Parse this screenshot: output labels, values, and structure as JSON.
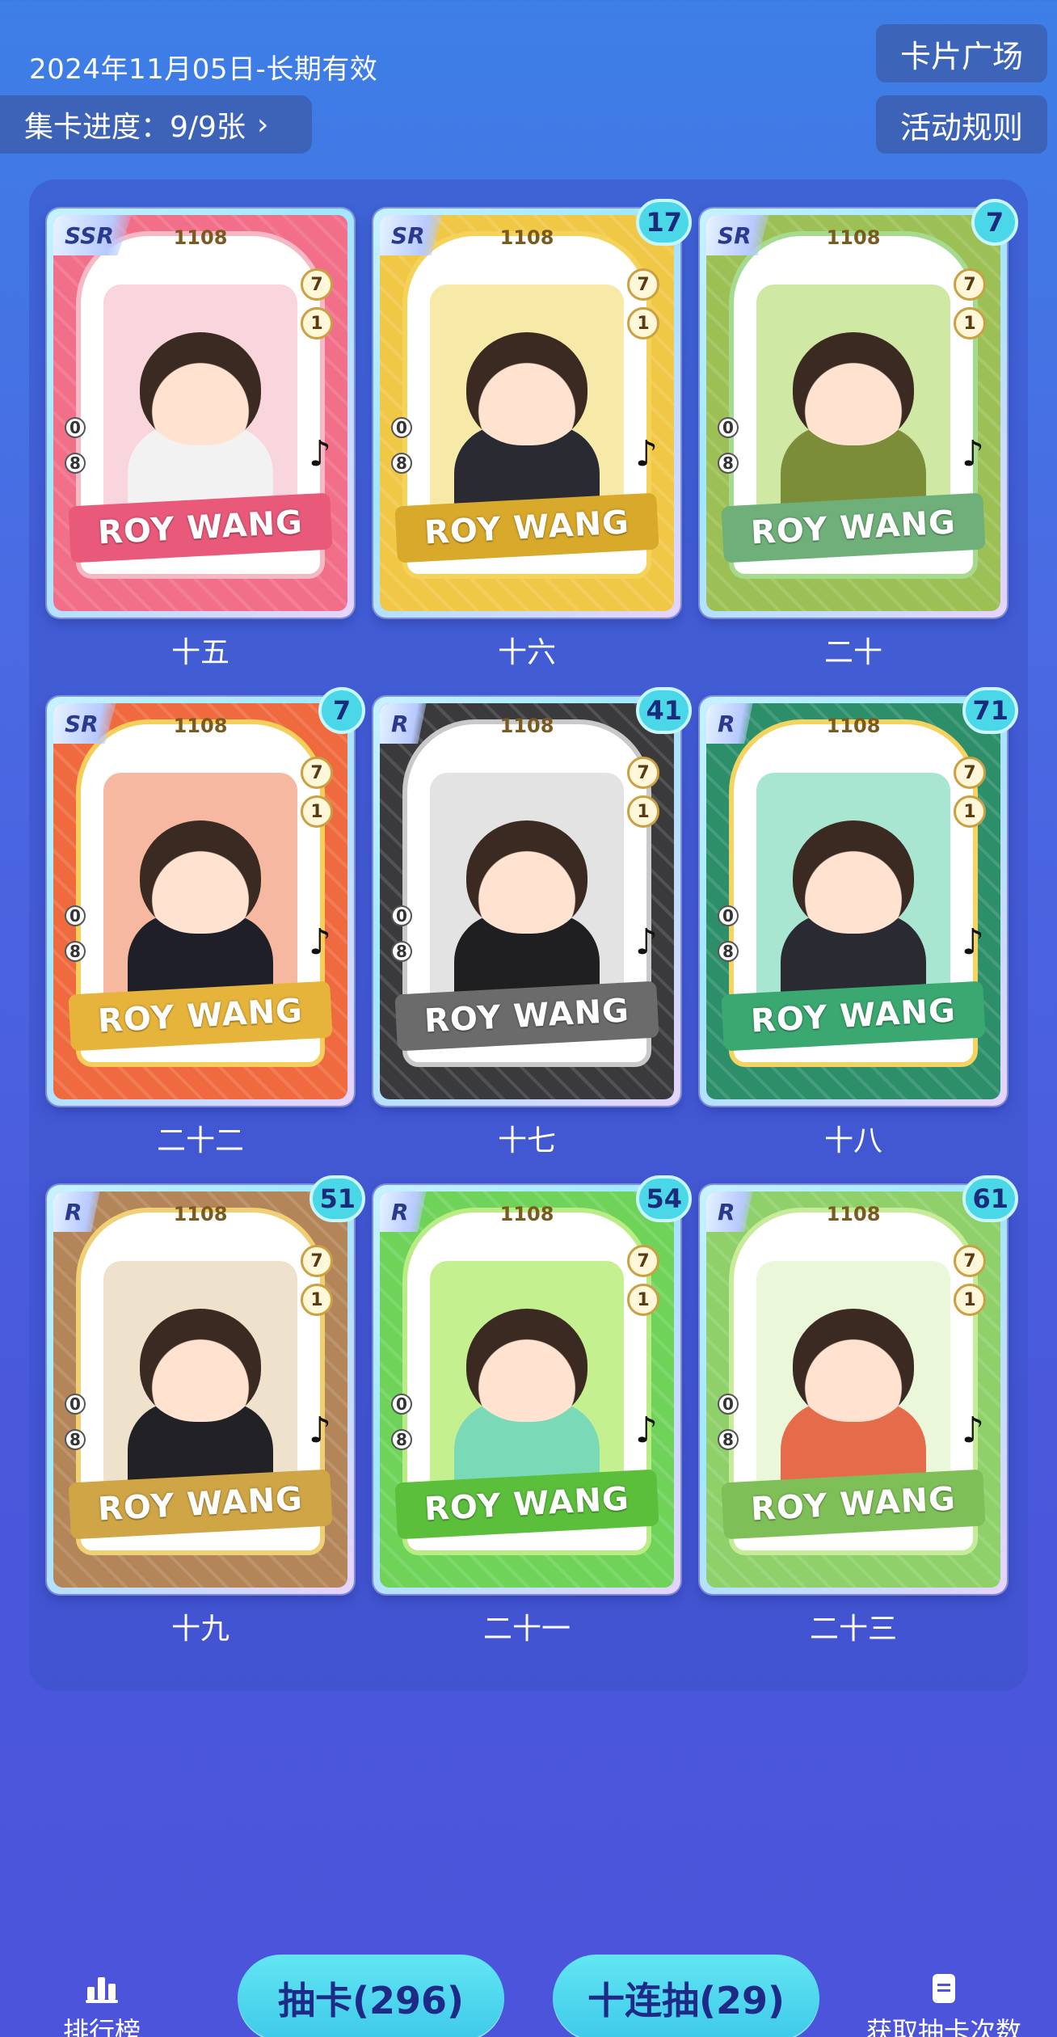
{
  "header": {
    "date_range": "2024年11月05日-长期有效",
    "progress_label": "集卡进度：9/9张",
    "chevron": "›",
    "card_square_button": "卡片广场",
    "rules_button": "活动规则"
  },
  "cards": [
    {
      "label": "十五",
      "rarity": "SSR",
      "count": "",
      "frame_no": "1108",
      "banner": "ROY WANG",
      "theme": {
        "bg": "#f26f8a",
        "frame": "#f4b9c4",
        "portrait": "#f9d6dd",
        "banner": "#e95a7a",
        "body": "#f2f2f2"
      }
    },
    {
      "label": "十六",
      "rarity": "SR",
      "count": "17",
      "frame_no": "1108",
      "banner": "ROY WANG",
      "theme": {
        "bg": "#f0c846",
        "frame": "#f5d35b",
        "portrait": "#f7e9a8",
        "banner": "#d8a92a",
        "body": "#2a2a33"
      }
    },
    {
      "label": "二十",
      "rarity": "SR",
      "count": "7",
      "frame_no": "1108",
      "banner": "ROY WANG",
      "theme": {
        "bg": "#9cc055",
        "frame": "#a6db8f",
        "portrait": "#cfe9a5",
        "banner": "#6fb07a",
        "body": "#7c8d3a"
      }
    },
    {
      "label": "二十二",
      "rarity": "SR",
      "count": "7",
      "frame_no": "1108",
      "banner": "ROY WANG",
      "theme": {
        "bg": "#ef6a3e",
        "frame": "#f5cf5a",
        "portrait": "#f7b8a2",
        "banner": "#e6b43a",
        "body": "#1f1f2a"
      }
    },
    {
      "label": "十七",
      "rarity": "R",
      "count": "41",
      "frame_no": "1108",
      "banner": "ROY WANG",
      "theme": {
        "bg": "#3a3a3d",
        "frame": "#c9c9c9",
        "portrait": "#e3e3e3",
        "banner": "#6b6b6b",
        "body": "#1f1f22"
      }
    },
    {
      "label": "十八",
      "rarity": "R",
      "count": "71",
      "frame_no": "1108",
      "banner": "ROY WANG",
      "theme": {
        "bg": "#2c8f6a",
        "frame": "#f4d35e",
        "portrait": "#a8e6d2",
        "banner": "#3aa870",
        "body": "#2a2a33"
      }
    },
    {
      "label": "十九",
      "rarity": "R",
      "count": "51",
      "frame_no": "1108",
      "banner": "ROY WANG",
      "theme": {
        "bg": "#b38559",
        "frame": "#f0d075",
        "portrait": "#efe2cc",
        "banner": "#cfa546",
        "body": "#222226"
      }
    },
    {
      "label": "二十一",
      "rarity": "R",
      "count": "54",
      "frame_no": "1108",
      "banner": "ROY WANG",
      "theme": {
        "bg": "#6fd35a",
        "frame": "#b9ec84",
        "portrait": "#c5f08f",
        "banner": "#5cbf3c",
        "body": "#7ad9b6"
      }
    },
    {
      "label": "二十三",
      "rarity": "R",
      "count": "61",
      "frame_no": "1108",
      "banner": "ROY WANG",
      "theme": {
        "bg": "#8fd06a",
        "frame": "#c6ec9a",
        "portrait": "#eaf7d8",
        "banner": "#7fbf58",
        "body": "#e66b4a"
      }
    }
  ],
  "bottom_nav": {
    "ranking_label": "排行榜",
    "draw_button": "抽卡(296)",
    "ten_draw_button": "十连抽(29)",
    "get_draws_label": "获取抽卡次数"
  },
  "icons": {
    "ranking": "bar-chart-icon",
    "get_draws": "document-icon",
    "music": "music-note-icon"
  }
}
